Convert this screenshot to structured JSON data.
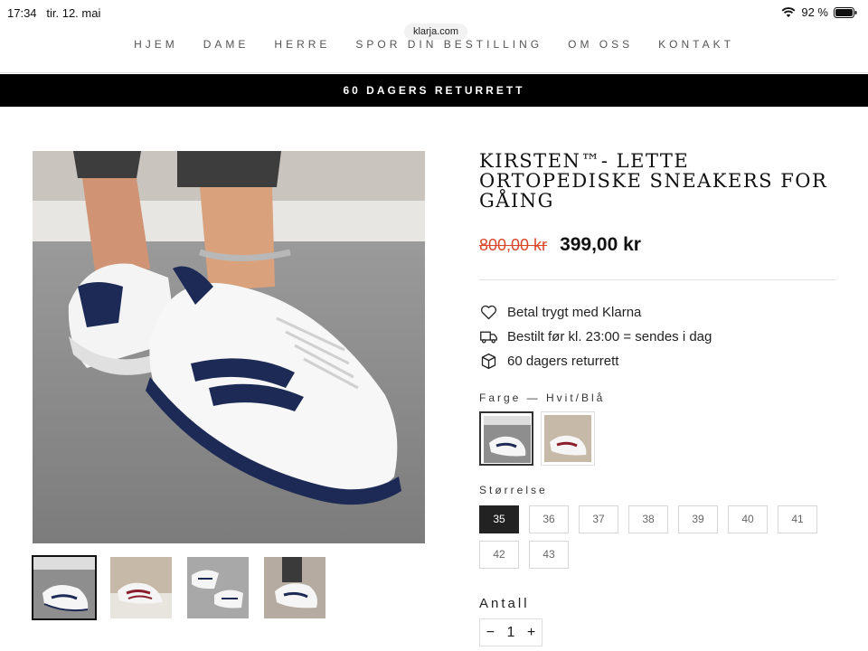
{
  "status_bar": {
    "time": "17:34",
    "date": "tir. 12. mai",
    "battery": "92 %",
    "url": "klarja.com"
  },
  "nav": {
    "items": [
      "Hjem",
      "Dame",
      "Herre",
      "Spor din bestilling",
      "Om oss",
      "Kontakt"
    ]
  },
  "announcement": "60 DAGERS RETURRETT",
  "product": {
    "title": "KIRSTEN™- LETTE ORTOPEDISKE SNEAKERS FOR GÅING",
    "price_old": "800,00 kr",
    "price_new": "399,00 kr",
    "perks": [
      {
        "icon": "heart-icon",
        "text": "Betal trygt med Klarna"
      },
      {
        "icon": "truck-icon",
        "text": "Bestilt før kl. 23:00 = sendes i dag"
      },
      {
        "icon": "box-icon",
        "text": "60 dagers returrett"
      }
    ],
    "color_label": "Farge — Hvit/Blå",
    "colors": [
      {
        "name": "Hvit/Blå",
        "accent": "#1c2a55",
        "selected": true
      },
      {
        "name": "Hvit/Rød",
        "accent": "#8a1f2b",
        "selected": false
      }
    ],
    "size_label": "Størrelse",
    "sizes": [
      "35",
      "36",
      "37",
      "38",
      "39",
      "40",
      "41",
      "42",
      "43"
    ],
    "selected_size": "35",
    "qty_label": "Antall",
    "qty_minus": "−",
    "qty_value": "1",
    "qty_plus": "+"
  },
  "gallery": {
    "thumbnails": [
      {
        "accent": "#1c2a55",
        "active": true
      },
      {
        "accent": "#8a1f2b",
        "active": false
      },
      {
        "accent": "#1c2a55",
        "active": false
      },
      {
        "accent": "#1c2a55",
        "active": false
      }
    ]
  },
  "colors": {
    "announcement_bg": "#000000",
    "sale_price": "#d9472b",
    "accent_navy": "#1c2a55"
  }
}
